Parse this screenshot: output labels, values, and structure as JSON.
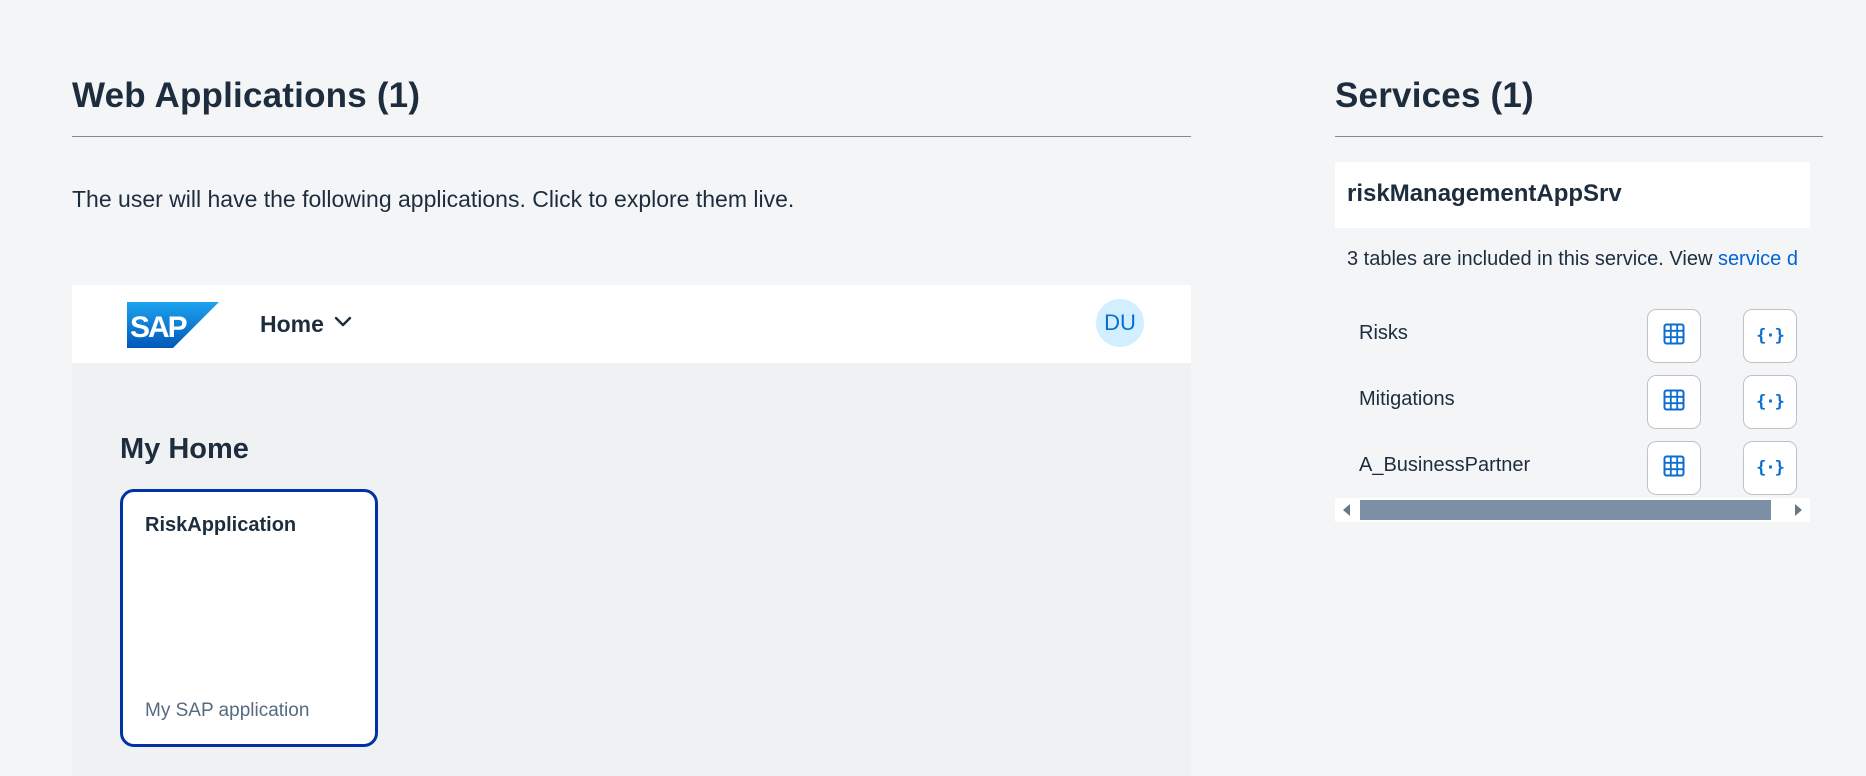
{
  "web_apps": {
    "title": "Web Applications (1)",
    "description": "The user will have the following applications. Click to explore them live.",
    "preview": {
      "logo_text": "SAP",
      "home_menu_label": "Home",
      "avatar_initials": "DU",
      "page_heading": "My Home",
      "tile": {
        "title": "RiskApplication",
        "subtitle": "My SAP application"
      }
    }
  },
  "services": {
    "title": "Services (1)",
    "service_name": "riskManagementAppSrv",
    "info_text": "3 tables are included in this service. View ",
    "info_link": "service d",
    "tables": [
      {
        "name": "Risks",
        "grid_icon": "table-grid-icon",
        "json_icon": "json-braces-icon"
      },
      {
        "name": "Mitigations",
        "grid_icon": "table-grid-icon",
        "json_icon": "json-braces-icon"
      },
      {
        "name": "A_BusinessPartner",
        "grid_icon": "table-grid-icon",
        "json_icon": "json-braces-icon"
      }
    ]
  },
  "colors": {
    "accent": "#0a6ed1",
    "tile_border": "#0032a5",
    "avatar_bg": "#d1efff",
    "background": "#f4f5f7"
  }
}
